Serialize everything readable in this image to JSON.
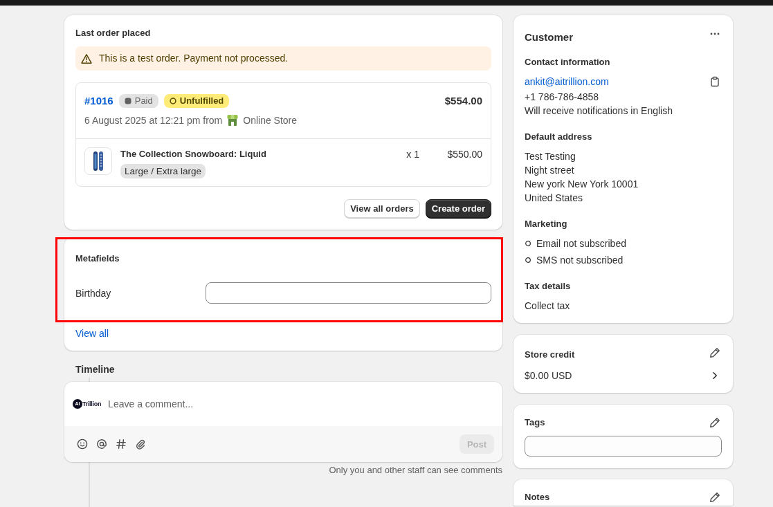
{
  "last_order": {
    "title": "Last order placed",
    "banner": "This is a test order. Payment not processed.",
    "order": {
      "number": "#1016",
      "badges": [
        {
          "label": "Paid",
          "kind": "paid"
        },
        {
          "label": "Unfulfilled",
          "kind": "unfulfilled"
        }
      ],
      "total": "$554.00",
      "placed": "6 August 2025 at 12:21 pm from",
      "channel": "Online Store",
      "line_items": [
        {
          "title": "The Collection Snowboard: Liquid",
          "variant": "Large / Extra large",
          "quantity": "x 1",
          "price": "$550.00"
        }
      ]
    },
    "buttons": [
      {
        "label": "View all orders",
        "kind": "secondary"
      },
      {
        "label": "Create order",
        "kind": "primary"
      }
    ]
  },
  "metafields": {
    "title": "Metafields",
    "highlighted": true,
    "fields": [
      {
        "label": "Birthday"
      }
    ],
    "link": "View all"
  },
  "timeline": {
    "title": "Timeline",
    "comment": {
      "logo": {
        "mark": "AI",
        "text": "Trillion"
      },
      "placeholder": "Leave a comment...",
      "post_button": {
        "label": "Post",
        "disabled": true
      }
    },
    "note": "Only you and other staff can see comments"
  },
  "customer": {
    "title": "Customer",
    "contact": {
      "title": "Contact information",
      "email": "ankit@aitrillion.com",
      "phone": "+1 786-786-4858",
      "language_note": "Will receive notifications in English"
    },
    "default_address": {
      "title": "Default address",
      "lines": [
        "Test Testing",
        "Night street",
        "New york New York 10001",
        "United States"
      ]
    },
    "marketing": {
      "title": "Marketing",
      "items": [
        {
          "label": "Email not subscribed",
          "subscribed": false
        },
        {
          "label": "SMS not subscribed",
          "subscribed": false
        }
      ]
    },
    "tax_details": {
      "title": "Tax details",
      "value": "Collect tax"
    }
  },
  "store_credit": {
    "title": "Store credit",
    "amount": "$0.00 USD"
  },
  "tags": {
    "title": "Tags"
  },
  "notes": {
    "title": "Notes"
  }
}
